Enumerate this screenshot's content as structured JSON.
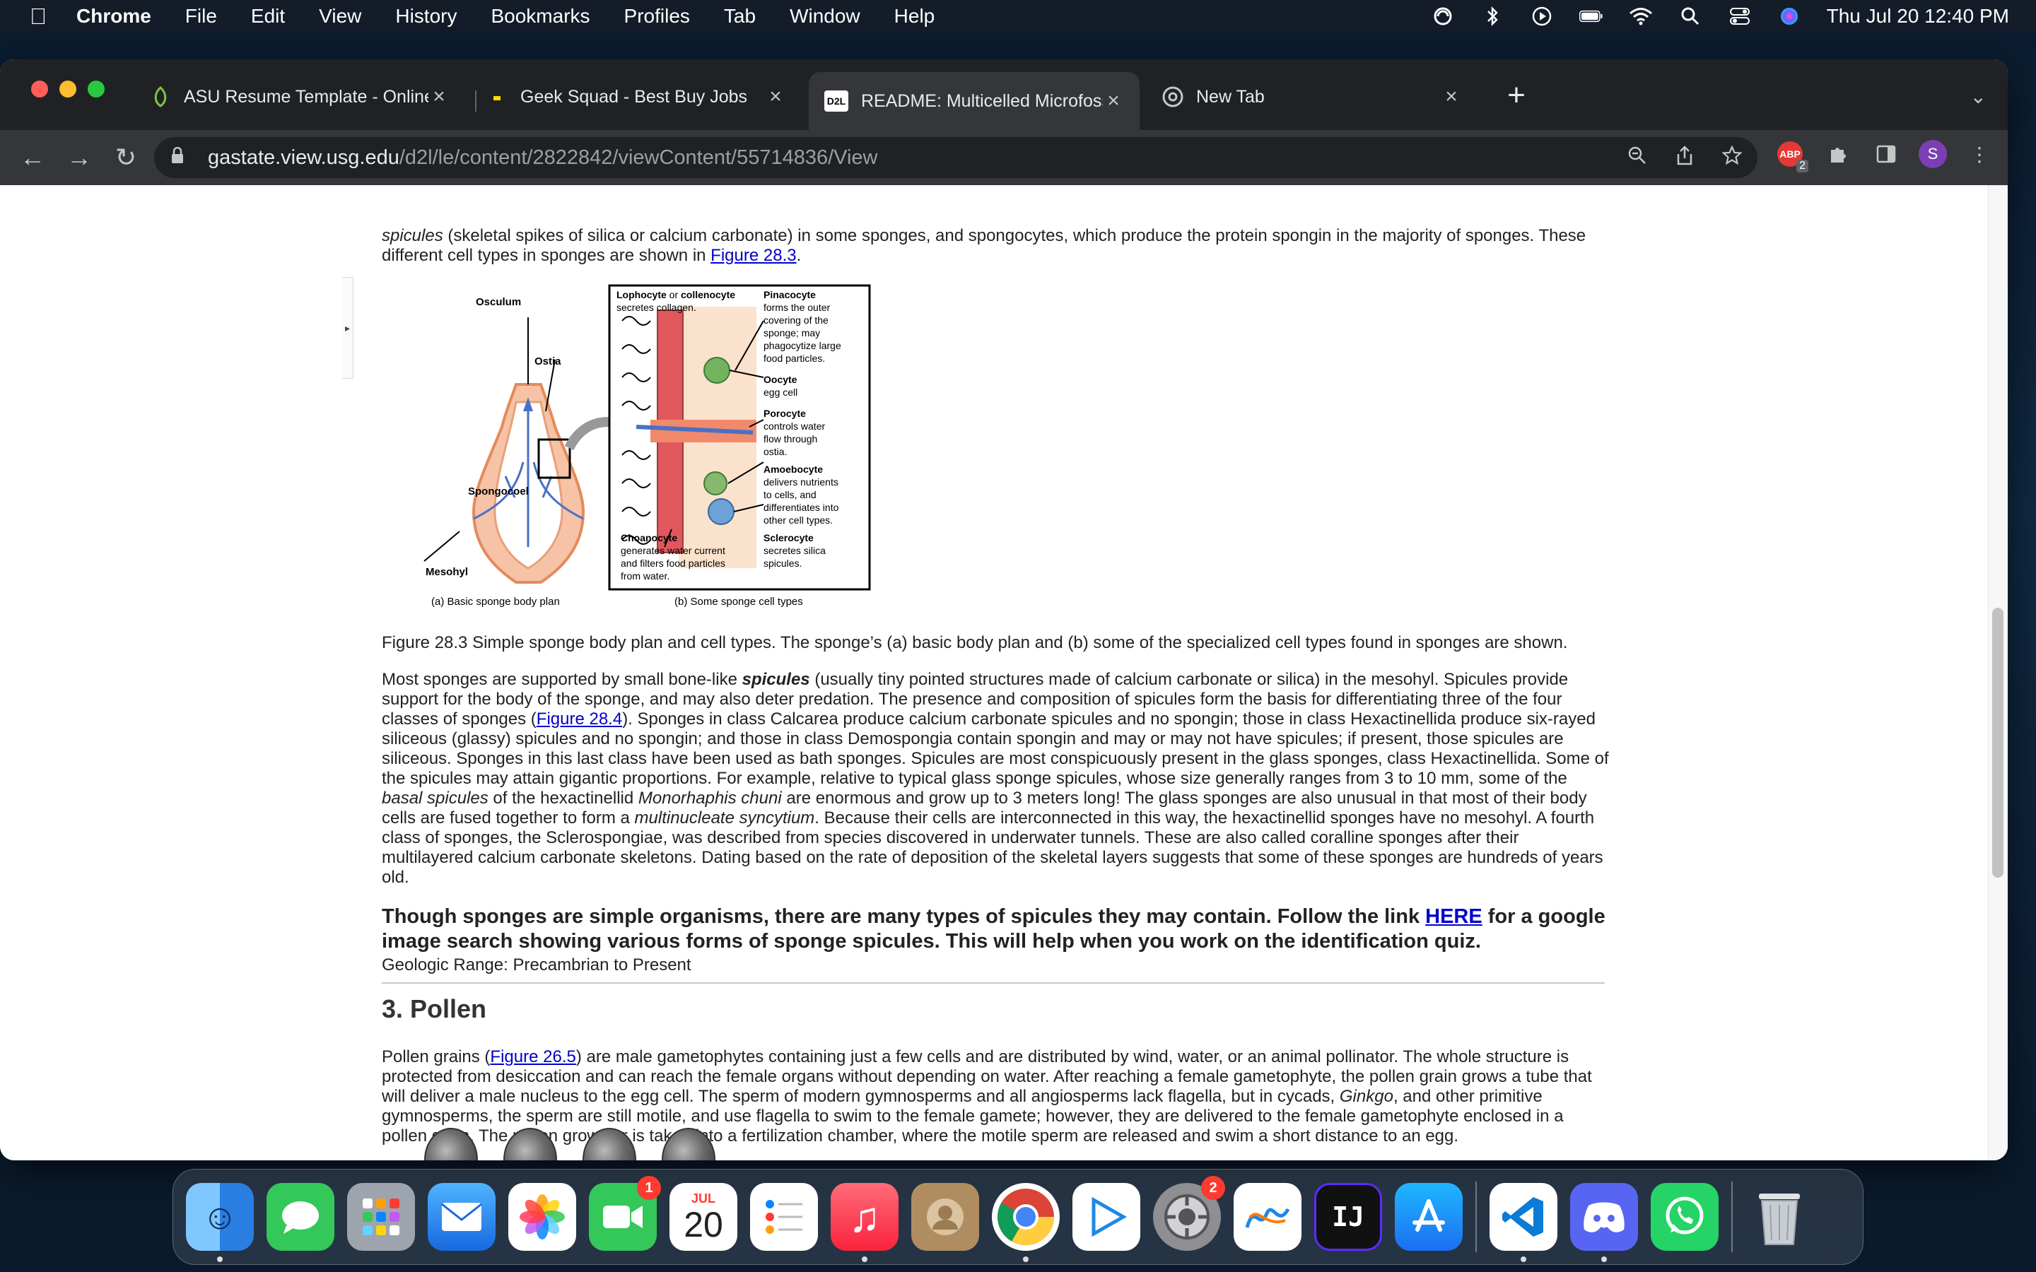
{
  "menubar": {
    "app_name": "Chrome",
    "menus": [
      "File",
      "Edit",
      "View",
      "History",
      "Bookmarks",
      "Profiles",
      "Tab",
      "Window",
      "Help"
    ],
    "clock": "Thu Jul 20  12:40 PM"
  },
  "tabs": [
    {
      "title": "ASU Resume Template - Online",
      "icon": "asu-favicon-icon",
      "active": false
    },
    {
      "title": "Geek Squad - Best Buy Jobs",
      "icon": "bestbuy-favicon-icon",
      "active": false
    },
    {
      "title": "README: Multicelled Microfoss",
      "icon": "d2l-favicon-icon",
      "icon_text": "D2L",
      "active": true
    },
    {
      "title": "New Tab",
      "icon": "chrome-favicon-icon",
      "active": false
    }
  ],
  "address_bar": {
    "host": "gastate.view.usg.edu",
    "path": "/d2l/le/content/2822842/viewContent/55714836/View"
  },
  "extensions": {
    "abp_label": "ABP",
    "abp_badge": "2",
    "profile_initial": "S"
  },
  "article": {
    "intro_em": "spicules",
    "intro_text": " (skeletal spikes of silica or calcium carbonate) in some sponges, and spongocytes, which produce the protein spongin in the majority of sponges. These different cell types in sponges are shown in ",
    "intro_link": "Figure 28.3",
    "intro_end": ".",
    "figure": {
      "labels": {
        "osculum": "Osculum",
        "ostia": "Ostia",
        "spongocoel": "Spongocoel",
        "mesohyl": "Mesohyl",
        "caption_a": "(a) Basic sponge body plan",
        "caption_b": "(b) Some sponge cell types",
        "lophocyte_title": "Lophocyte",
        "lophocyte_or": " or ",
        "collenocyte_title": "collenocyte",
        "lophocyte_desc": "secretes collagen.",
        "pinacocyte_title": "Pinacocyte",
        "pinacocyte_desc": [
          "forms the outer",
          "covering of the",
          "sponge; may",
          "phagocytize large",
          "food particles."
        ],
        "oocyte_title": "Oocyte",
        "oocyte_desc": "egg cell",
        "porocyte_title": "Porocyte",
        "porocyte_desc": [
          "controls water",
          "flow through",
          "ostia."
        ],
        "amoebocyte_title": "Amoebocyte",
        "amoebocyte_desc": [
          "delivers nutrients",
          "to cells, and",
          "differentiates into",
          "other cell types."
        ],
        "choanocyte_title": "Choanocyte",
        "choanocyte_desc": [
          "generates water current",
          "and filters food particles",
          "from water."
        ],
        "sclerocyte_title": "Sclerocyte",
        "sclerocyte_desc": [
          "secretes silica",
          "spicules."
        ]
      }
    },
    "fig_caption": "Figure 28.3 Simple sponge body plan and cell types. The sponge’s (a) basic body plan and (b) some of the specialized cell types found in sponges are shown.",
    "p2": {
      "a": "Most sponges are supported by small bone-like ",
      "b_em": "spicules",
      "c": " (usually tiny pointed structures made of calcium carbonate or silica) in the mesohyl. Spicules provide support for the body of the sponge, and may also deter predation. The presence and composition of spicules form the basis for differentiating three of the four classes of sponges (",
      "link": "Figure 28.4",
      "d": "). Sponges in class Calcarea produce calcium carbonate spicules and no spongin; those in class Hexactinellida produce six-rayed siliceous (glassy) spicules and no spongin; and those in class Demospongia contain spongin and may or may not have spicules; if present, those spicules are siliceous. Sponges in this last class have been used as bath sponges. Spicules are most conspicuously present in the glass sponges, class Hexactinellida. Some of the spicules may attain gigantic proportions. For example, relative to typical glass sponge spicules, whose size generally ranges from 3 to 10 mm, some of the ",
      "e_em": "basal spicules",
      "f": " of the hexactinellid ",
      "g_em": "Monorhaphis chuni",
      "h": " are enormous and grow up to 3 meters long! The glass sponges are also unusual in that most of their body cells are fused together to form a ",
      "i_em": "multinucleate syncytium",
      "j": ". Because their cells are interconnected in this way, the hexactinellid sponges have no mesohyl. A fourth class of sponges, the Sclerospongiae, was described from species discovered in underwater tunnels. These are also called coralline sponges after their multilayered calcium carbonate skeletons. Dating based on the rate of deposition of the skeletal layers suggests that some of these sponges are hundreds of years old."
    },
    "callout": {
      "a": "Though sponges are simple organisms, there are many types of spicules they may contain.  Follow the link ",
      "link": "HERE",
      "b": " for a google image search showing various forms of sponge spicules.  This will help when you work on the identification quiz."
    },
    "geologic_range": "Geologic Range: Precambrian to Present",
    "section_heading": "3.  Pollen",
    "p3": {
      "a": "Pollen grains (",
      "link": "Figure 26.5",
      "b": ") are male gametophytes containing just a few cells and are distributed by wind, water, or an animal pollinator. The whole structure is protected from desiccation and can reach the female organs without depending on water. After reaching a female gametophyte, the pollen grain grows a tube that will deliver a male nucleus to the egg cell. The sperm of modern gymnosperms and all angiosperms lack flagella, but in cycads, ",
      "c_em": "Ginkgo",
      "d": ", and other primitive gymnosperms, the sperm are still motile, and use flagella to swim to the female gamete; however, they are delivered to the female gametophyte enclosed in a pollen grain. The pollen grows or is taken into a fertilization chamber, where the motile sperm are released and swim a short distance to an egg."
    }
  },
  "dock": {
    "items": [
      {
        "name": "finder-icon",
        "color": "#2b8ef0",
        "glyph": "☺"
      },
      {
        "name": "messages-icon",
        "color": "#34c759",
        "glyph": "💬"
      },
      {
        "name": "launchpad-icon",
        "color": "#8e8e93",
        "glyph": "▦"
      },
      {
        "name": "mail-icon",
        "color": "#1e88e5",
        "glyph": "✉"
      },
      {
        "name": "photos-icon",
        "color": "#f5f5f5",
        "glyph": "✿"
      },
      {
        "name": "facetime-icon",
        "color": "#34c759",
        "glyph": "▶",
        "badge": "1"
      },
      {
        "name": "calendar-icon",
        "color": "#ffffff",
        "glyph": "20",
        "month": "JUL"
      },
      {
        "name": "reminders-icon",
        "color": "#ffffff",
        "glyph": "☰"
      },
      {
        "name": "music-icon",
        "color": "#fc3c44",
        "glyph": "♫"
      },
      {
        "name": "contacts-icon",
        "color": "#b08d60",
        "glyph": "☻"
      },
      {
        "name": "chrome-icon",
        "color": "#ffffff",
        "glyph": "◉"
      },
      {
        "name": "media-player-icon",
        "color": "#ffffff",
        "glyph": "▷"
      },
      {
        "name": "system-settings-icon",
        "color": "#8e8e93",
        "glyph": "⚙",
        "badge": "2"
      },
      {
        "name": "freeform-icon",
        "color": "#ffffff",
        "glyph": "~"
      },
      {
        "name": "intellij-icon",
        "color": "#111111",
        "glyph": "IJ"
      },
      {
        "name": "app-store-icon",
        "color": "#1c8ef9",
        "glyph": "A"
      },
      {
        "name": "vscode-icon",
        "color": "#ffffff",
        "glyph": "≺"
      },
      {
        "name": "discord-icon",
        "color": "#5865f2",
        "glyph": "☺"
      },
      {
        "name": "whatsapp-icon",
        "color": "#25d366",
        "glyph": "✆"
      },
      {
        "name": "trash-icon",
        "color": "#c7cdd3",
        "glyph": "🗑"
      }
    ]
  }
}
